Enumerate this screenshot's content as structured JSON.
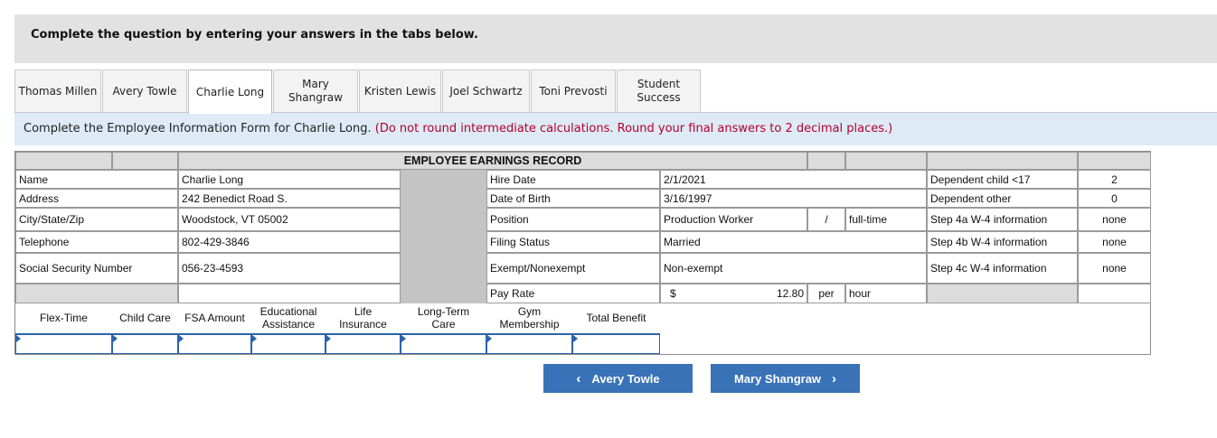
{
  "header": {
    "instruction": "Complete the question by entering your answers in the tabs below."
  },
  "tabs": [
    {
      "label": "Thomas Millen"
    },
    {
      "label": "Avery Towle"
    },
    {
      "label": "Charlie Long"
    },
    {
      "label": "Mary Shangraw"
    },
    {
      "label": "Kristen Lewis"
    },
    {
      "label": "Joel Schwartz"
    },
    {
      "label": "Toni Prevosti"
    },
    {
      "label": "Student Success"
    }
  ],
  "active_tab": "Charlie Long",
  "instruction": {
    "main": "Complete the Employee Information Form for Charlie Long.",
    "note": "(Do not round intermediate calculations. Round your final answers to 2 decimal places.)"
  },
  "record": {
    "title": "EMPLOYEE EARNINGS RECORD",
    "labels": {
      "name": "Name",
      "address": "Address",
      "city": "City/State/Zip",
      "telephone": "Telephone",
      "ssn": "Social Security Number",
      "hire_date": "Hire Date",
      "dob": "Date of Birth",
      "position": "Position",
      "filing_status": "Filing Status",
      "exempt": "Exempt/Nonexempt",
      "pay_rate": "Pay Rate",
      "dep_child": "Dependent child <17",
      "dep_other": "Dependent other",
      "step4a": "Step 4a W-4 information",
      "step4b": "Step 4b W-4 information",
      "step4c": "Step 4c W-4 information"
    },
    "values": {
      "name": "Charlie Long",
      "address": "242 Benedict Road S.",
      "city": "Woodstock, VT 05002",
      "telephone": "802-429-3846",
      "ssn": "056-23-4593",
      "hire_date": "2/1/2021",
      "dob": "3/16/1997",
      "position": "Production Worker",
      "slash": "/",
      "employment": "full-time",
      "filing_status": "Married",
      "exempt": "Non-exempt",
      "pay_currency": "$",
      "pay_rate": "12.80",
      "pay_per": "per",
      "pay_unit": "hour",
      "dep_child": "2",
      "dep_other": "0",
      "step4a": "none",
      "step4b": "none",
      "step4c": "none"
    },
    "benefit_headers": [
      "Flex-Time",
      "Child Care",
      "FSA Amount",
      "Educational Assistance",
      "Life Insurance",
      "Long-Term Care",
      "Gym Membership",
      "Total Benefit"
    ],
    "benefit_values": [
      "",
      "",
      "",
      "",
      "",
      "",
      "",
      ""
    ]
  },
  "nav": {
    "prev_label": "Avery Towle",
    "next_label": "Mary Shangraw"
  }
}
